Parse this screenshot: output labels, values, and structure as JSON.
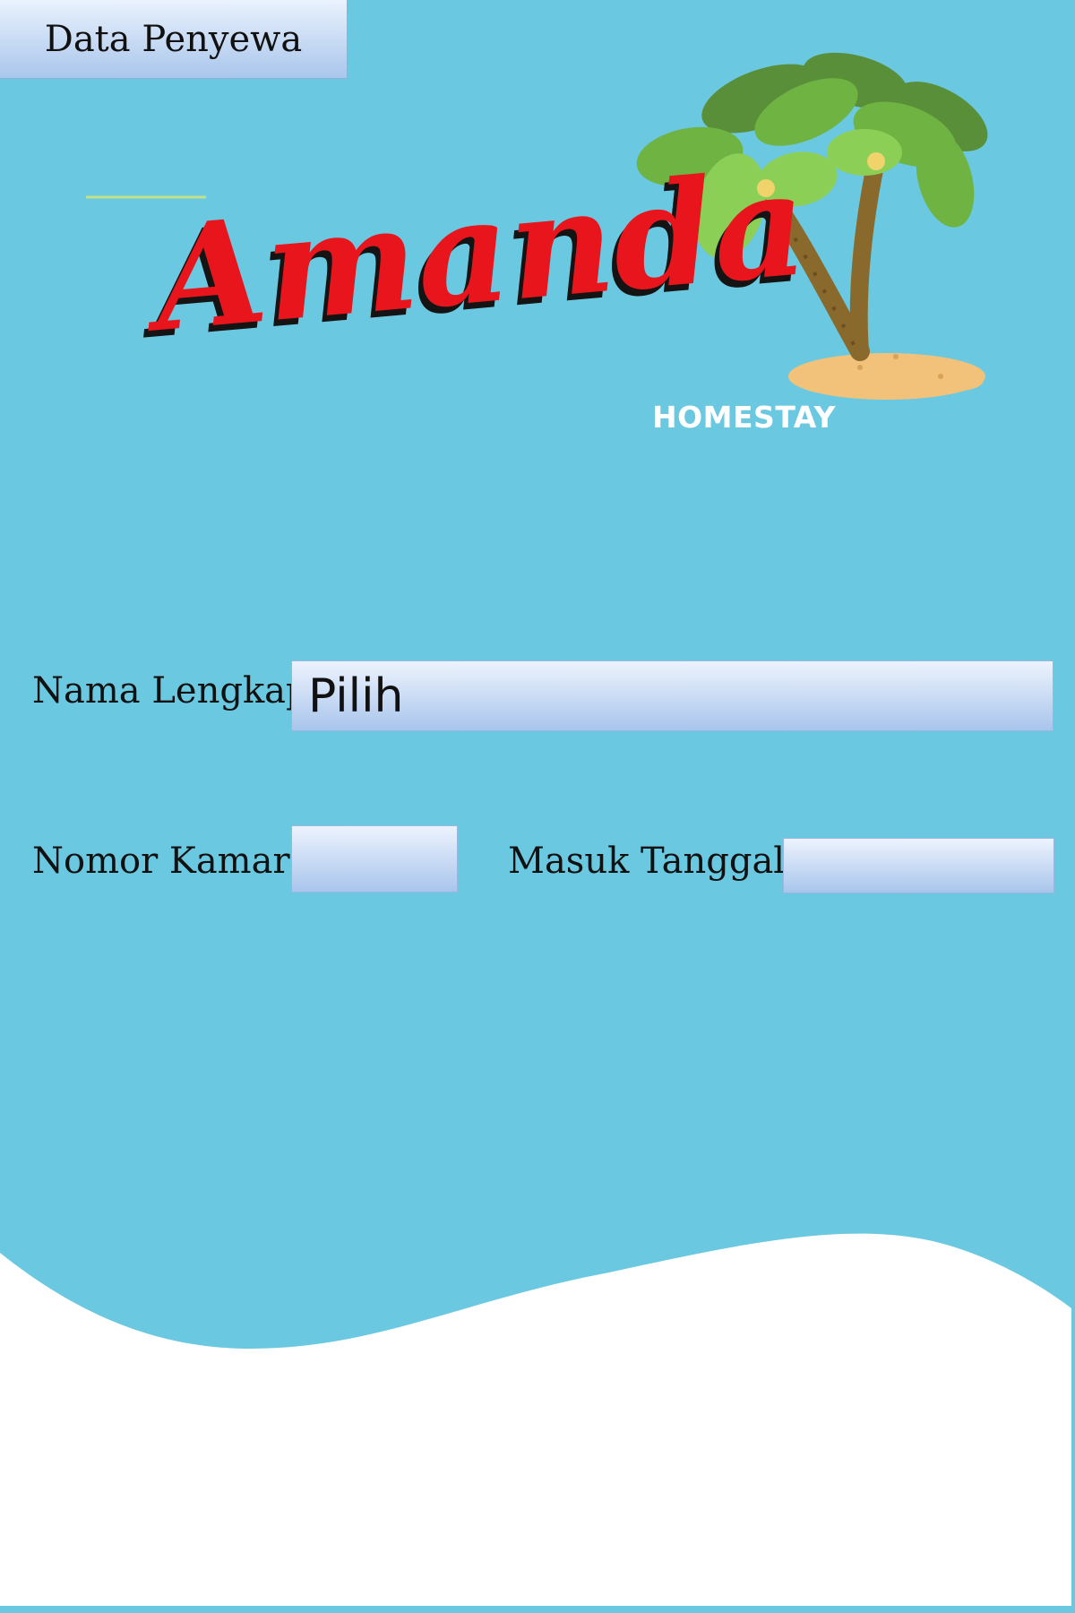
{
  "header": {
    "tab_label": "Data Penyewa"
  },
  "logo": {
    "brand_name": "Amanda",
    "tagline": "HOMESTAY",
    "icon": "palm-island-icon"
  },
  "form": {
    "full_name": {
      "label": "Nama Lengkap",
      "value": "Pilih"
    },
    "room_number": {
      "label": "Nomor Kamar",
      "value": ""
    },
    "check_in_date": {
      "label": "Masuk Tanggal",
      "value": ""
    }
  },
  "colors": {
    "background": "#6bc8e1",
    "brand_red": "#e8151c",
    "footer": "#ffffff"
  }
}
